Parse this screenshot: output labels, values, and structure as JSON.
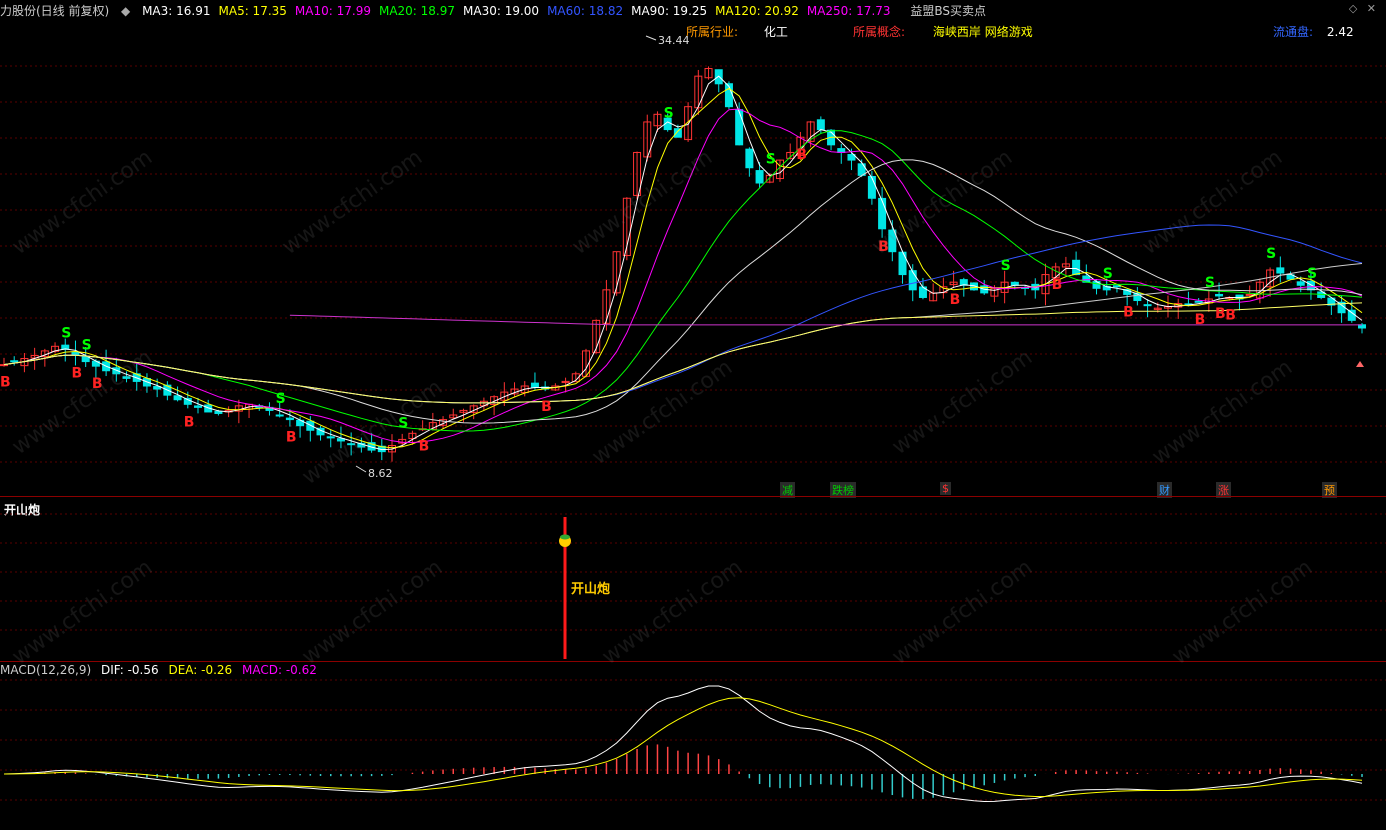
{
  "header": {
    "title": "力股份(日线 前复权)",
    "indicator_name": "益盟BS买卖点",
    "ma": [
      {
        "label": "MA3: 16.91",
        "color": "#ffffff"
      },
      {
        "label": "MA5: 17.35",
        "color": "#ffff00"
      },
      {
        "label": "MA10: 17.99",
        "color": "#ff00ff"
      },
      {
        "label": "MA20: 18.97",
        "color": "#00ff00"
      },
      {
        "label": "MA30: 19.00",
        "color": "#ffffff"
      },
      {
        "label": "MA60: 18.82",
        "color": "#3355ff"
      },
      {
        "label": "MA90: 19.25",
        "color": "#ffffff"
      },
      {
        "label": "MA120: 20.92",
        "color": "#ffff00"
      },
      {
        "label": "MA250: 17.73",
        "color": "#ff00ff"
      }
    ]
  },
  "info": {
    "industry_label": "所属行业:",
    "industry_value": "化工",
    "concept_label": "所属概念:",
    "concept_value": "海峡西岸 网络游戏",
    "float_label": "流通盘:",
    "float_value": "2.42"
  },
  "event_tags": [
    {
      "text": "减",
      "color": "#00cc00"
    },
    {
      "text": "跌榜",
      "color": "#00cc00"
    },
    {
      "text": "$",
      "color": "#ff3333"
    },
    {
      "text": "财",
      "color": "#3399ff"
    },
    {
      "text": "涨",
      "color": "#ff3333"
    },
    {
      "text": "预",
      "color": "#ff9900"
    }
  ],
  "signal_pane": {
    "title": "开山炮",
    "marker_label": "开山炮"
  },
  "macd": {
    "label_name": "MACD(12,26,9)",
    "dif": "DIF: -0.56",
    "dea": "DEA: -0.26",
    "macd": "MACD: -0.62"
  },
  "watermark": "www.cfchi.com",
  "chart_data": {
    "type": "candlestick",
    "price_range": [
      7.5,
      36
    ],
    "annotations": [
      {
        "text": "34.44",
        "kind": "high"
      },
      {
        "text": "8.62",
        "kind": "low"
      }
    ],
    "buy_signal_label": "B",
    "sell_signal_label": "S",
    "close_series": [
      14.6,
      14.8,
      15.0,
      15.2,
      15.5,
      15.8,
      15.6,
      15.2,
      14.8,
      14.5,
      14.2,
      14.0,
      13.7,
      13.5,
      13.2,
      13.0,
      12.6,
      12.3,
      12.0,
      11.8,
      11.5,
      11.4,
      11.6,
      11.9,
      12.0,
      11.8,
      11.6,
      11.3,
      11.0,
      10.6,
      10.3,
      10.0,
      9.8,
      9.6,
      9.4,
      9.2,
      9.0,
      8.9,
      9.3,
      9.7,
      10.1,
      10.4,
      10.8,
      11.0,
      11.3,
      11.6,
      11.9,
      12.2,
      12.5,
      12.8,
      13.0,
      13.2,
      13.1,
      13.0,
      13.2,
      13.5,
      14.0,
      15.5,
      17.5,
      19.5,
      22.0,
      25.5,
      28.5,
      30.5,
      31.0,
      30.0,
      29.5,
      31.5,
      33.5,
      34.0,
      33.0,
      31.5,
      29.0,
      27.5,
      26.5,
      27.0,
      28.0,
      28.5,
      29.5,
      30.5,
      30.0,
      29.0,
      28.5,
      28.0,
      27.0,
      25.5,
      23.5,
      22.0,
      20.5,
      19.5,
      19.0,
      19.3,
      19.7,
      20.0,
      19.8,
      19.5,
      19.3,
      19.6,
      20.0,
      19.8,
      19.6,
      19.5,
      20.5,
      21.0,
      21.2,
      20.5,
      20.0,
      19.6,
      19.5,
      19.7,
      19.2,
      18.8,
      18.5,
      18.3,
      18.4,
      18.6,
      18.5,
      18.7,
      18.9,
      19.1,
      19.0,
      18.9,
      19.2,
      20.0,
      20.8,
      20.6,
      20.2,
      19.8,
      19.5,
      19.0,
      18.5,
      18.0,
      17.5,
      17.0
    ]
  }
}
